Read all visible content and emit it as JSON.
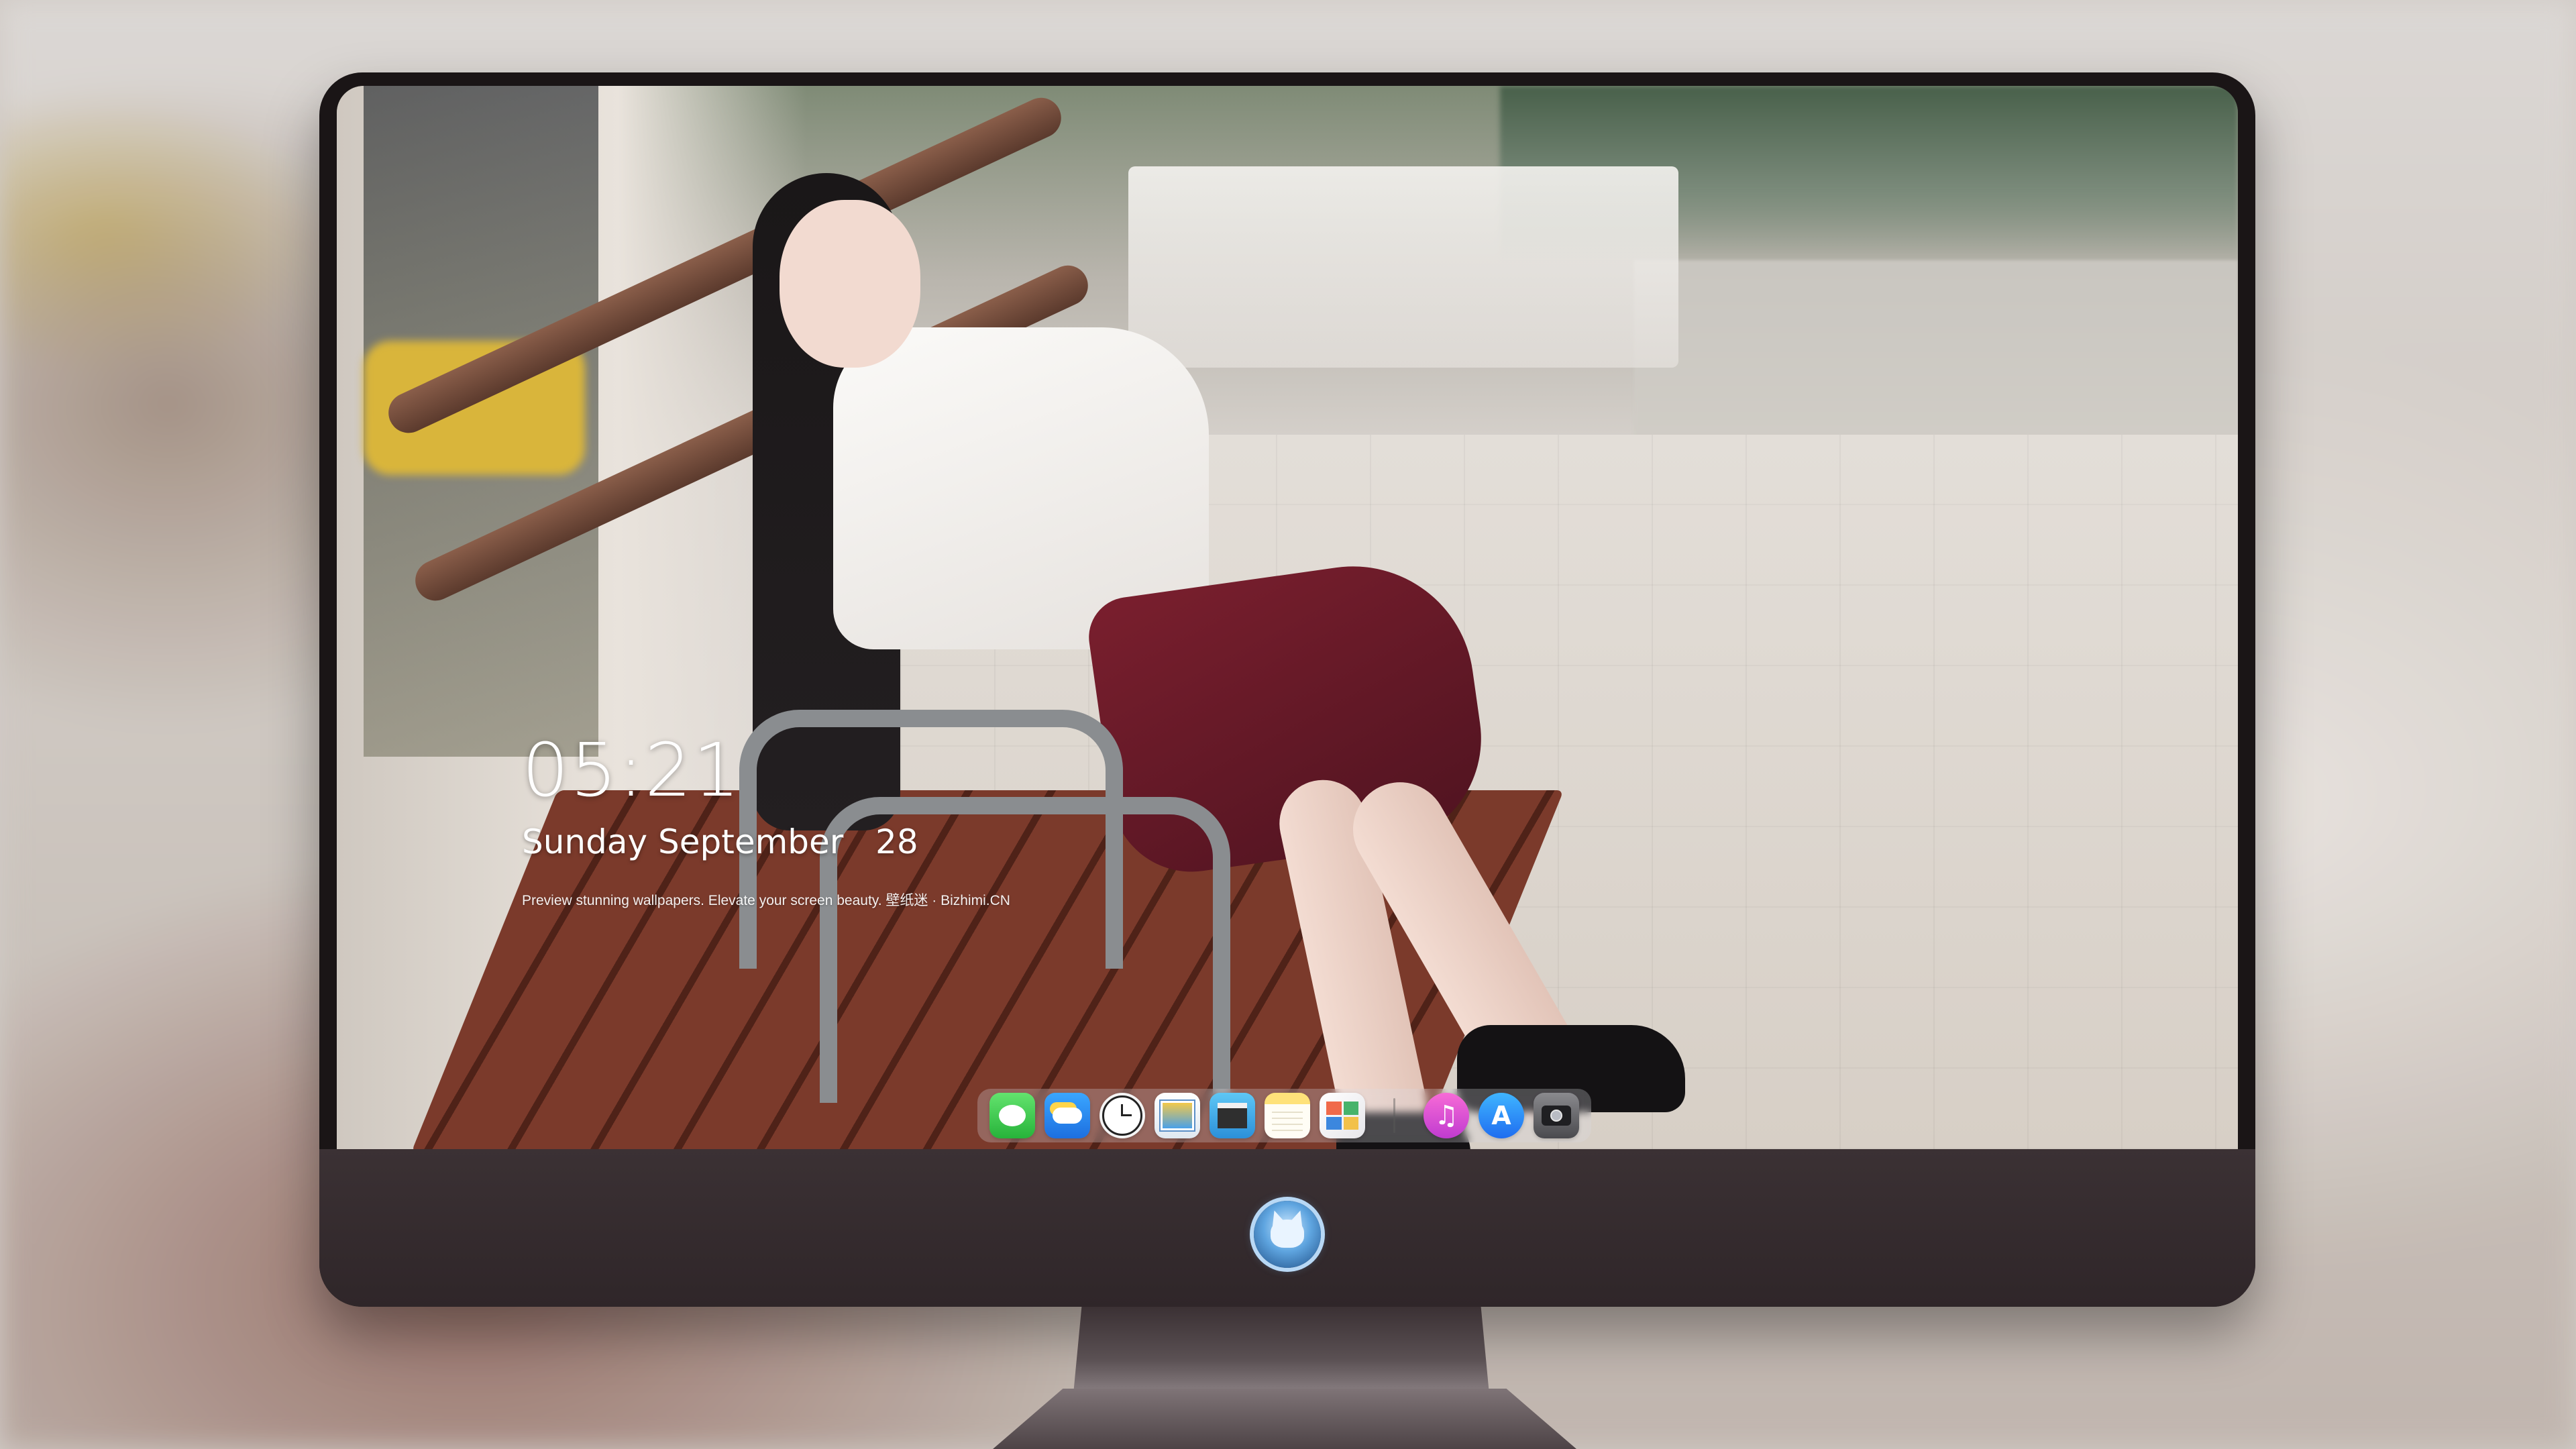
{
  "lockscreen": {
    "time": "05:21",
    "date": "Sunday September   28",
    "tagline": "Preview stunning wallpapers. Elevate your screen beauty. 壁纸迷 · Bizhimi.CN"
  },
  "dock": {
    "items": [
      {
        "name": "messages",
        "icon": "messages-icon",
        "color": "#2fbf45"
      },
      {
        "name": "weather",
        "icon": "weather-icon",
        "color": "#1d7cf0"
      },
      {
        "name": "clock",
        "icon": "clock-icon",
        "color": "#f4f4f4"
      },
      {
        "name": "preview",
        "icon": "preview-icon",
        "color": "#5b8fc7"
      },
      {
        "name": "clips",
        "icon": "clips-icon",
        "color": "#3aa8e8"
      },
      {
        "name": "notes",
        "icon": "notes-icon",
        "color": "#ffe27a"
      },
      {
        "name": "photo-booth",
        "icon": "photo-booth-icon",
        "color": "#f06a4a"
      },
      {
        "name": "music",
        "icon": "music-icon",
        "glyph": "♫",
        "color": "#e054d4"
      },
      {
        "name": "app-store",
        "icon": "app-store-icon",
        "glyph": "A",
        "color": "#2a8cf5"
      },
      {
        "name": "camera",
        "icon": "camera-icon",
        "color": "#6a6a6e"
      }
    ]
  },
  "monitor": {
    "bezel_color": "#1a1516",
    "chin_color": "#352b2e",
    "logo_icon": "mascot-logo-icon"
  }
}
